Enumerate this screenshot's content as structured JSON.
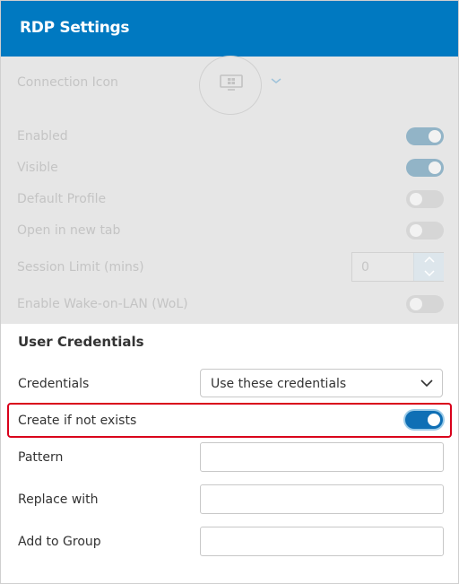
{
  "header": {
    "title": "RDP Settings"
  },
  "disabled_section": {
    "connection_icon_label": "Connection Icon",
    "enabled_label": "Enabled",
    "enabled_value": true,
    "visible_label": "Visible",
    "visible_value": true,
    "default_profile_label": "Default Profile",
    "default_profile_value": false,
    "open_new_tab_label": "Open in new tab",
    "open_new_tab_value": false,
    "session_limit_label": "Session Limit (mins)",
    "session_limit_value": "0",
    "wol_label": "Enable Wake-on-LAN (WoL)",
    "wol_value": false
  },
  "credentials": {
    "section_title": "User Credentials",
    "credentials_label": "Credentials",
    "credentials_value": "Use these credentials",
    "create_label": "Create if not exists",
    "create_value": true,
    "pattern_label": "Pattern",
    "pattern_value": "",
    "replace_label": "Replace with",
    "replace_value": "",
    "group_label": "Add to Group",
    "group_value": ""
  },
  "colors": {
    "header_bg": "#0079c1",
    "toggle_on": "#0f6fb5",
    "highlight": "#d9001b",
    "disabled_bg": "#e6e6e6"
  },
  "icons": [
    "monitor-icon",
    "chevron-down-icon",
    "chevron-up-icon"
  ]
}
